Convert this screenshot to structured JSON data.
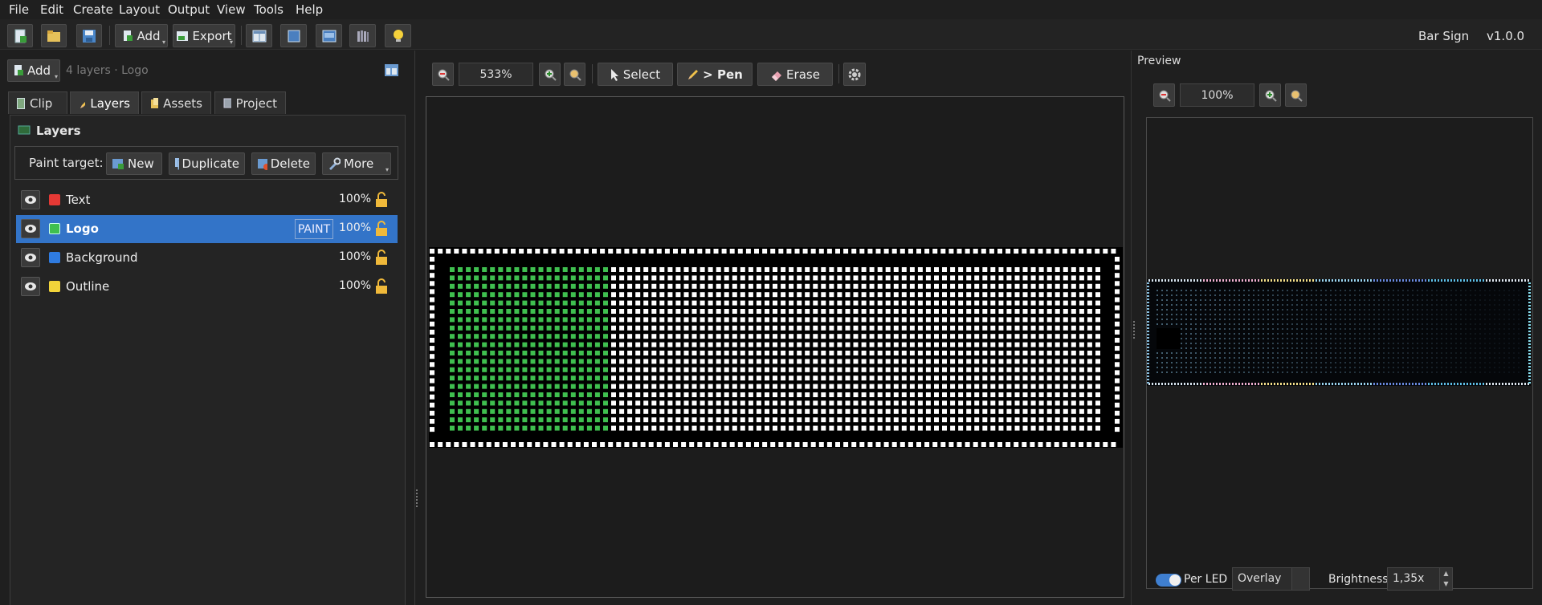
{
  "menu": [
    "File",
    "Edit",
    "Create",
    "Layout",
    "Output",
    "View",
    "Tools",
    "Help"
  ],
  "toolbar": {
    "add_label": "Add",
    "export_label": "Export",
    "app_name": "Bar Sign",
    "version": "v1.0.0"
  },
  "left": {
    "add_label": "Add",
    "summary": "4 layers · Logo",
    "tabs": [
      {
        "label": "Clip",
        "icon": "clip-icon"
      },
      {
        "label": "Layers",
        "icon": "pencil-icon"
      },
      {
        "label": "Assets",
        "icon": "assets-icon"
      },
      {
        "label": "Project",
        "icon": "project-icon"
      }
    ],
    "layers_title": "Layers",
    "paint_target": "Paint target: l",
    "buttons": {
      "new": "New",
      "duplicate": "Duplicate",
      "delete": "Delete",
      "more": "More"
    },
    "layers": [
      {
        "name": "Text",
        "color": "#e53935",
        "opacity": "100%",
        "selected": false
      },
      {
        "name": "Logo",
        "color": "#3fbf4f",
        "opacity": "100%",
        "selected": true,
        "tag": "PAINT"
      },
      {
        "name": "Background",
        "color": "#2f7be0",
        "opacity": "100%",
        "selected": false
      },
      {
        "name": "Outline",
        "color": "#f2d43a",
        "opacity": "100%",
        "selected": false
      }
    ]
  },
  "editor": {
    "zoom": "533%",
    "select_label": "Select",
    "pen_label": "> Pen",
    "erase_label": "Erase"
  },
  "preview": {
    "title": "Preview",
    "zoom": "100%",
    "per_led_label": "Per LED",
    "per_led_on": true,
    "mode": "Overlay",
    "brightness_label": "Brightness",
    "brightness": "1,35x"
  },
  "colors": {
    "accent": "#3374c8",
    "logo_led": "#3fbf4f",
    "led_white": "#ffffff"
  }
}
